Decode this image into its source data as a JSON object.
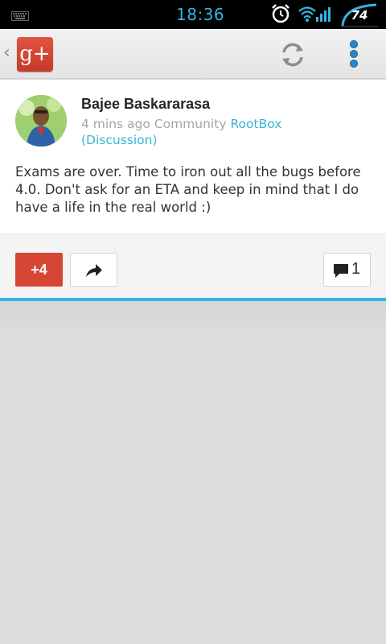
{
  "status_bar": {
    "time": "18:36",
    "battery_level": "74",
    "accent_color": "#33b5e5",
    "icons": [
      "keyboard-icon",
      "alarm-icon",
      "wifi-icon",
      "signal-icon",
      "battery-gauge"
    ]
  },
  "action_bar": {
    "up_caret": "‹",
    "logo_text": "g+",
    "icons": [
      "refresh-icon",
      "overflow-menu-icon"
    ]
  },
  "post": {
    "author": "Bajee Baskararasa",
    "time_ago": "4 mins ago",
    "audience_type": "Community",
    "community": "RootBox",
    "category": "(Discussion)",
    "text": "Exams are over. Time to iron out all the bugs before 4.0. Don't ask for an ETA and keep in mind that I do have a life in the real world :)"
  },
  "actions": {
    "plus_one_label": "+4",
    "comment_count": "1",
    "plus_one_color": "#d64635"
  }
}
